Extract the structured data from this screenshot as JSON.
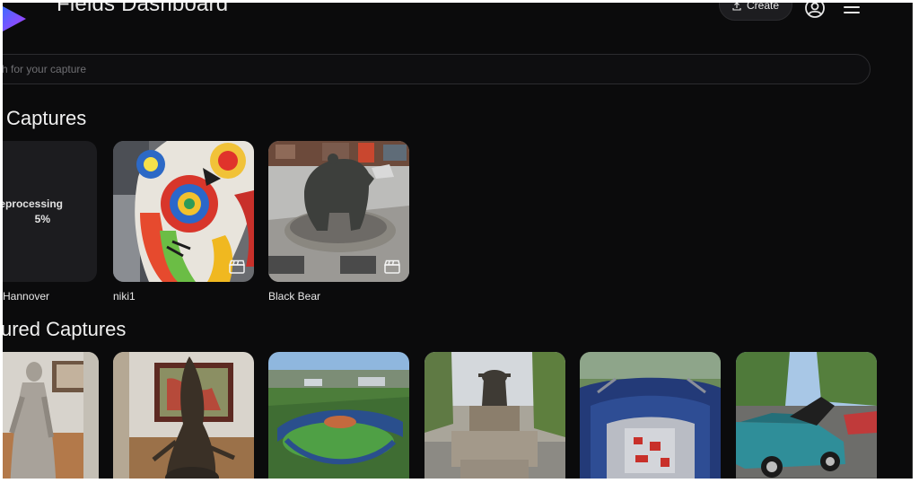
{
  "header": {
    "title": "Fields Dashboard",
    "create_label": "Create"
  },
  "search": {
    "placeholder": "h for your capture"
  },
  "my_captures": {
    "title": "Captures",
    "items": [
      {
        "label": "Hannover",
        "status": "eprocessing",
        "progress_text": "5%"
      },
      {
        "label": "niki1",
        "icon": "clapperboard-icon"
      },
      {
        "label": "Black Bear",
        "icon": "clapperboard-icon"
      }
    ]
  },
  "featured_captures": {
    "title": "ured Captures",
    "items": [
      {
        "thumb": "statue-woman"
      },
      {
        "thumb": "sculpture-museum"
      },
      {
        "thumb": "baseball-stadium"
      },
      {
        "thumb": "yoda-fountain"
      },
      {
        "thumb": "football-stadium"
      },
      {
        "thumb": "classic-car"
      }
    ]
  },
  "colors": {
    "background": "#0b0b0c",
    "card_background": "#1c1c1f",
    "logo_gradient_start": "#4b5bff",
    "logo_gradient_end": "#b03cff"
  }
}
